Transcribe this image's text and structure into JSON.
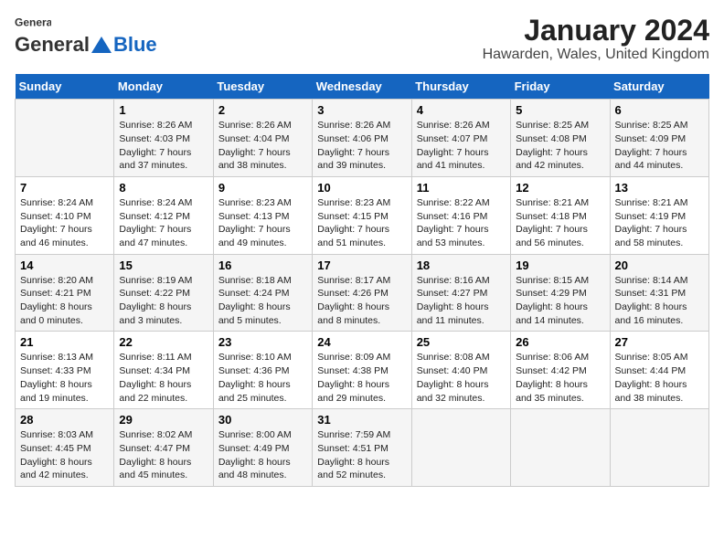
{
  "logo": {
    "general": "General",
    "blue": "Blue"
  },
  "title": "January 2024",
  "subtitle": "Hawarden, Wales, United Kingdom",
  "days_of_week": [
    "Sunday",
    "Monday",
    "Tuesday",
    "Wednesday",
    "Thursday",
    "Friday",
    "Saturday"
  ],
  "weeks": [
    [
      {
        "day": "",
        "sunrise": "",
        "sunset": "",
        "daylight": ""
      },
      {
        "day": "1",
        "sunrise": "Sunrise: 8:26 AM",
        "sunset": "Sunset: 4:03 PM",
        "daylight": "Daylight: 7 hours and 37 minutes."
      },
      {
        "day": "2",
        "sunrise": "Sunrise: 8:26 AM",
        "sunset": "Sunset: 4:04 PM",
        "daylight": "Daylight: 7 hours and 38 minutes."
      },
      {
        "day": "3",
        "sunrise": "Sunrise: 8:26 AM",
        "sunset": "Sunset: 4:06 PM",
        "daylight": "Daylight: 7 hours and 39 minutes."
      },
      {
        "day": "4",
        "sunrise": "Sunrise: 8:26 AM",
        "sunset": "Sunset: 4:07 PM",
        "daylight": "Daylight: 7 hours and 41 minutes."
      },
      {
        "day": "5",
        "sunrise": "Sunrise: 8:25 AM",
        "sunset": "Sunset: 4:08 PM",
        "daylight": "Daylight: 7 hours and 42 minutes."
      },
      {
        "day": "6",
        "sunrise": "Sunrise: 8:25 AM",
        "sunset": "Sunset: 4:09 PM",
        "daylight": "Daylight: 7 hours and 44 minutes."
      }
    ],
    [
      {
        "day": "7",
        "sunrise": "Sunrise: 8:24 AM",
        "sunset": "Sunset: 4:10 PM",
        "daylight": "Daylight: 7 hours and 46 minutes."
      },
      {
        "day": "8",
        "sunrise": "Sunrise: 8:24 AM",
        "sunset": "Sunset: 4:12 PM",
        "daylight": "Daylight: 7 hours and 47 minutes."
      },
      {
        "day": "9",
        "sunrise": "Sunrise: 8:23 AM",
        "sunset": "Sunset: 4:13 PM",
        "daylight": "Daylight: 7 hours and 49 minutes."
      },
      {
        "day": "10",
        "sunrise": "Sunrise: 8:23 AM",
        "sunset": "Sunset: 4:15 PM",
        "daylight": "Daylight: 7 hours and 51 minutes."
      },
      {
        "day": "11",
        "sunrise": "Sunrise: 8:22 AM",
        "sunset": "Sunset: 4:16 PM",
        "daylight": "Daylight: 7 hours and 53 minutes."
      },
      {
        "day": "12",
        "sunrise": "Sunrise: 8:21 AM",
        "sunset": "Sunset: 4:18 PM",
        "daylight": "Daylight: 7 hours and 56 minutes."
      },
      {
        "day": "13",
        "sunrise": "Sunrise: 8:21 AM",
        "sunset": "Sunset: 4:19 PM",
        "daylight": "Daylight: 7 hours and 58 minutes."
      }
    ],
    [
      {
        "day": "14",
        "sunrise": "Sunrise: 8:20 AM",
        "sunset": "Sunset: 4:21 PM",
        "daylight": "Daylight: 8 hours and 0 minutes."
      },
      {
        "day": "15",
        "sunrise": "Sunrise: 8:19 AM",
        "sunset": "Sunset: 4:22 PM",
        "daylight": "Daylight: 8 hours and 3 minutes."
      },
      {
        "day": "16",
        "sunrise": "Sunrise: 8:18 AM",
        "sunset": "Sunset: 4:24 PM",
        "daylight": "Daylight: 8 hours and 5 minutes."
      },
      {
        "day": "17",
        "sunrise": "Sunrise: 8:17 AM",
        "sunset": "Sunset: 4:26 PM",
        "daylight": "Daylight: 8 hours and 8 minutes."
      },
      {
        "day": "18",
        "sunrise": "Sunrise: 8:16 AM",
        "sunset": "Sunset: 4:27 PM",
        "daylight": "Daylight: 8 hours and 11 minutes."
      },
      {
        "day": "19",
        "sunrise": "Sunrise: 8:15 AM",
        "sunset": "Sunset: 4:29 PM",
        "daylight": "Daylight: 8 hours and 14 minutes."
      },
      {
        "day": "20",
        "sunrise": "Sunrise: 8:14 AM",
        "sunset": "Sunset: 4:31 PM",
        "daylight": "Daylight: 8 hours and 16 minutes."
      }
    ],
    [
      {
        "day": "21",
        "sunrise": "Sunrise: 8:13 AM",
        "sunset": "Sunset: 4:33 PM",
        "daylight": "Daylight: 8 hours and 19 minutes."
      },
      {
        "day": "22",
        "sunrise": "Sunrise: 8:11 AM",
        "sunset": "Sunset: 4:34 PM",
        "daylight": "Daylight: 8 hours and 22 minutes."
      },
      {
        "day": "23",
        "sunrise": "Sunrise: 8:10 AM",
        "sunset": "Sunset: 4:36 PM",
        "daylight": "Daylight: 8 hours and 25 minutes."
      },
      {
        "day": "24",
        "sunrise": "Sunrise: 8:09 AM",
        "sunset": "Sunset: 4:38 PM",
        "daylight": "Daylight: 8 hours and 29 minutes."
      },
      {
        "day": "25",
        "sunrise": "Sunrise: 8:08 AM",
        "sunset": "Sunset: 4:40 PM",
        "daylight": "Daylight: 8 hours and 32 minutes."
      },
      {
        "day": "26",
        "sunrise": "Sunrise: 8:06 AM",
        "sunset": "Sunset: 4:42 PM",
        "daylight": "Daylight: 8 hours and 35 minutes."
      },
      {
        "day": "27",
        "sunrise": "Sunrise: 8:05 AM",
        "sunset": "Sunset: 4:44 PM",
        "daylight": "Daylight: 8 hours and 38 minutes."
      }
    ],
    [
      {
        "day": "28",
        "sunrise": "Sunrise: 8:03 AM",
        "sunset": "Sunset: 4:45 PM",
        "daylight": "Daylight: 8 hours and 42 minutes."
      },
      {
        "day": "29",
        "sunrise": "Sunrise: 8:02 AM",
        "sunset": "Sunset: 4:47 PM",
        "daylight": "Daylight: 8 hours and 45 minutes."
      },
      {
        "day": "30",
        "sunrise": "Sunrise: 8:00 AM",
        "sunset": "Sunset: 4:49 PM",
        "daylight": "Daylight: 8 hours and 48 minutes."
      },
      {
        "day": "31",
        "sunrise": "Sunrise: 7:59 AM",
        "sunset": "Sunset: 4:51 PM",
        "daylight": "Daylight: 8 hours and 52 minutes."
      },
      {
        "day": "",
        "sunrise": "",
        "sunset": "",
        "daylight": ""
      },
      {
        "day": "",
        "sunrise": "",
        "sunset": "",
        "daylight": ""
      },
      {
        "day": "",
        "sunrise": "",
        "sunset": "",
        "daylight": ""
      }
    ]
  ]
}
